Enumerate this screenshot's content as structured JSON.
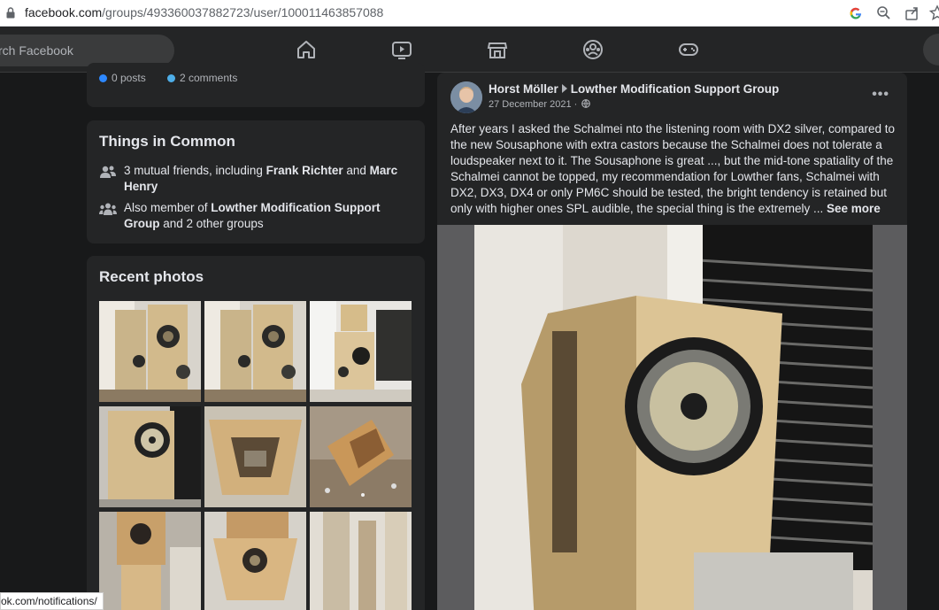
{
  "browser": {
    "url_host": "facebook.com",
    "url_path": "/groups/493360037882723/user/100011463857088",
    "icons": [
      "lock-icon",
      "google-icon",
      "zoom-icon",
      "share-icon",
      "bookmark-star-icon"
    ]
  },
  "topbar": {
    "search_placeholder": "rch Facebook",
    "nav": [
      "home-icon",
      "watch-icon",
      "marketplace-icon",
      "groups-icon",
      "gaming-icon"
    ]
  },
  "stats": {
    "posts": "0 posts",
    "comments": "2 comments",
    "posts_color": "#2d88ff",
    "comments_color": "#4eaee8"
  },
  "things_in_common": {
    "title": "Things in Common",
    "friends_prefix": "3 mutual friends, including ",
    "friend1": "Frank Richter",
    "friends_and": " and ",
    "friend2": "Marc Henry",
    "member_prefix": "Also member of ",
    "group": "Lowther Modification Support Group",
    "member_suffix": " and 2 other groups"
  },
  "recent_photos": {
    "title": "Recent photos"
  },
  "post": {
    "author": "Horst Möller",
    "group": "Lowther Modification Support Group",
    "date": "27 December 2021 ·",
    "privacy_icon": "globe-icon",
    "text": "After years I asked the Schalmei nto the listening room with DX2 silver, compared to the new Sousaphone with extra castors because the Schalmei does not tolerate a loudspeaker next to it. The Sousaphone is great ..., but the mid-tone spatiality of the Schalmei cannot be topped, my recommendation for Lowther fans, Schalmei with DX2, DX3, DX4 or only PM6C should be tested, the bright tendency is retained but only with higher ones SPL audible, the special thing is the extremely ... ",
    "see_more": "See more",
    "more_label": "•••"
  },
  "status_bar": {
    "text": "ok.com/notifications/"
  }
}
